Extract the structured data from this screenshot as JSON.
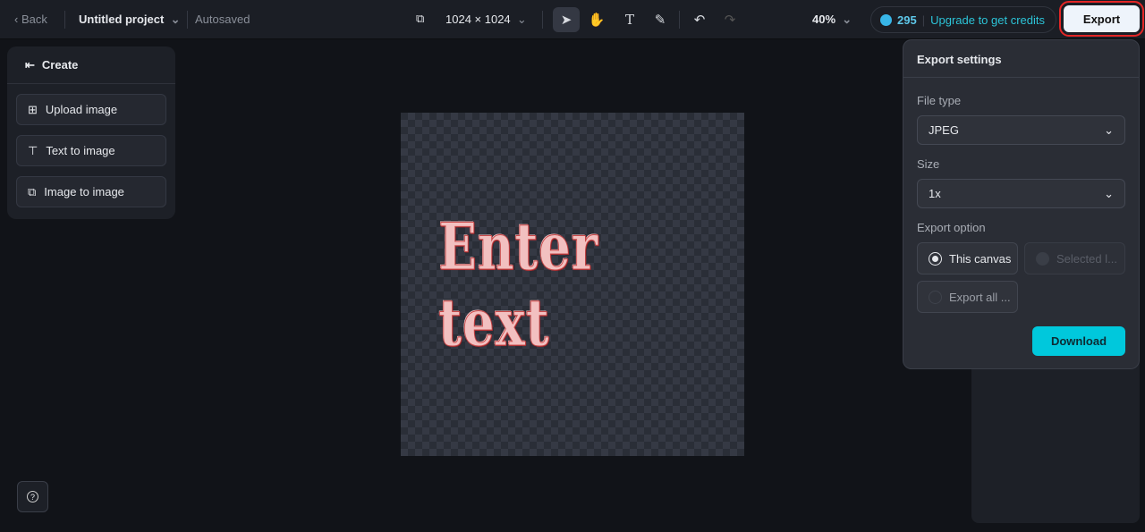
{
  "topbar": {
    "back": "Back",
    "project": "Untitled project",
    "status": "Autosaved",
    "canvas_size": "1024 × 1024",
    "zoom": "40%",
    "credits": "295",
    "upgrade": "Upgrade to get credits",
    "export": "Export"
  },
  "create": {
    "title": "Create",
    "items": [
      {
        "label": "Upload image"
      },
      {
        "label": "Text to image"
      },
      {
        "label": "Image to image"
      }
    ]
  },
  "canvas": {
    "text": "Enter text"
  },
  "export_settings": {
    "title": "Export settings",
    "file_type_label": "File type",
    "file_type": "JPEG",
    "size_label": "Size",
    "size": "1x",
    "option_label": "Export option",
    "options": [
      {
        "label": "This canvas"
      },
      {
        "label": "Selected l..."
      },
      {
        "label": "Export all ..."
      }
    ],
    "download": "Download"
  },
  "colors": {
    "accent": "#00c8dc",
    "highlight": "#e32626"
  }
}
